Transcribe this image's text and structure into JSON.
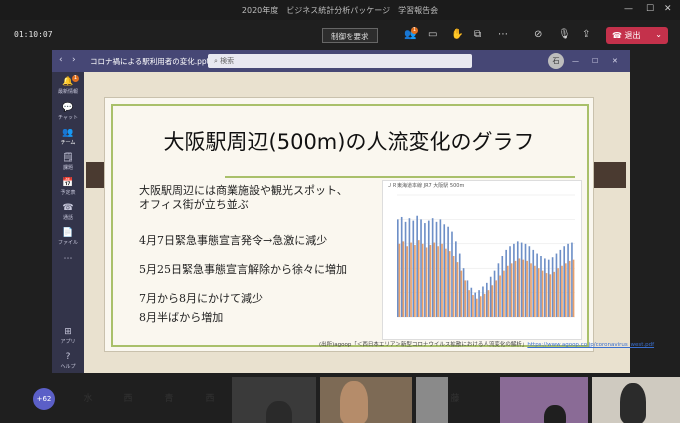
{
  "window": {
    "title": "2020年度　ビジネス統計分析パッケージ　学習報告会"
  },
  "call_bar": {
    "timer": "01:10:07",
    "control_request_label": "制御を要求",
    "participants_badge": "1",
    "leave_label": "退出"
  },
  "shared_window": {
    "filename": "コロナ禍による駅利用者の変化.pptx",
    "search_placeholder": "検索",
    "avatar_initial": "石",
    "sidebar": [
      {
        "label": "最新情報",
        "icon": "bell-icon",
        "badge": "1"
      },
      {
        "label": "チャット",
        "icon": "chat-icon"
      },
      {
        "label": "チーム",
        "icon": "team-icon"
      },
      {
        "label": "課題",
        "icon": "assignment-icon"
      },
      {
        "label": "予定表",
        "icon": "calendar-icon"
      },
      {
        "label": "通話",
        "icon": "phone-icon"
      },
      {
        "label": "ファイル",
        "icon": "file-icon"
      },
      {
        "label": "アプリ",
        "icon": "apps-icon"
      },
      {
        "label": "ヘルプ",
        "icon": "help-icon"
      }
    ]
  },
  "slide": {
    "title": "大阪駅周辺(500m)の人流変化のグラフ",
    "bullets": [
      "大阪駅周辺には商業施設や観光スポット、オフィス街が立ち並ぶ",
      "4月7日緊急事態宣言発令→急激に減少",
      "5月25日緊急事態宣言解除から徐々に増加",
      "7月から8月にかけて減少",
      "8月半ばから増加"
    ],
    "caption_prefix": "(出所)agoop「＜西日本エリア＞新型コロナウイルス拡散における人流変化の解析」",
    "caption_link": "https://www.agoop.co.jp/coronavirus_west.pdf",
    "chart_title": "ＪＲ東海道本線 JR7 大阪駅 500m"
  },
  "chart_data": {
    "type": "bar",
    "title": "ＪＲ東海道本線 JR7 大阪駅 500m",
    "series": [
      {
        "values": [
          80,
          82,
          78,
          81,
          79,
          83,
          80,
          77,
          79,
          81,
          78,
          80,
          76,
          74,
          70,
          62,
          52,
          40,
          30,
          24,
          20,
          22,
          25,
          28,
          33,
          38,
          44,
          50,
          55,
          58,
          60,
          62,
          61,
          60,
          58,
          55,
          52,
          50,
          48,
          47,
          49,
          52,
          55,
          58,
          60,
          61
        ]
      },
      {
        "values": [
          60,
          62,
          58,
          61,
          59,
          63,
          60,
          57,
          59,
          61,
          58,
          60,
          56,
          54,
          50,
          45,
          38,
          30,
          22,
          18,
          15,
          17,
          19,
          22,
          26,
          30,
          34,
          38,
          42,
          44,
          46,
          48,
          47,
          46,
          44,
          42,
          40,
          38,
          36,
          35,
          37,
          40,
          42,
          44,
          46,
          47
        ]
      }
    ],
    "colors": [
      "#6d8fc7",
      "#e8a06a"
    ],
    "ylim": [
      0,
      100
    ],
    "grid": true
  },
  "participants": {
    "overflow": "+62",
    "avatars": [
      {
        "initial": "水",
        "color": "#f2d9a7"
      },
      {
        "initial": "西",
        "color": "#cfe5ee"
      },
      {
        "initial": "青",
        "color": "#cfe8d0"
      },
      {
        "initial": "西",
        "color": "#f3cccc"
      },
      {
        "initial": "藤",
        "color": "#dfe8c9"
      }
    ]
  }
}
